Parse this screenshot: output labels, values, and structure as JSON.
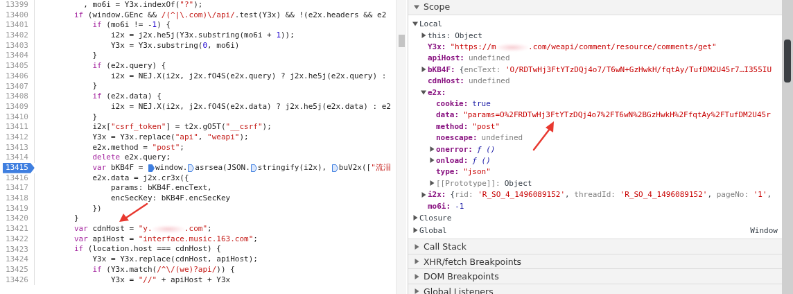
{
  "code": {
    "lines": [
      {
        "number": "13399",
        "breakpoint": false,
        "tokens": [
          {
            "kind": "plain",
            "text": "          , mo6i = Y3x.indexOf("
          },
          {
            "kind": "str",
            "text": "\"?\""
          },
          {
            "kind": "plain",
            "text": ");"
          }
        ]
      },
      {
        "number": "13400",
        "breakpoint": false,
        "tokens": [
          {
            "kind": "kw",
            "text": "        if"
          },
          {
            "kind": "plain",
            "text": " (window.GEnc && "
          },
          {
            "kind": "str",
            "text": "/(^|\\.com)\\/api/"
          },
          {
            "kind": "plain",
            "text": ".test(Y3x) && !(e2x.headers && e2"
          }
        ]
      },
      {
        "number": "13401",
        "breakpoint": false,
        "tokens": [
          {
            "kind": "kw",
            "text": "            if"
          },
          {
            "kind": "plain",
            "text": " (mo6i != -"
          },
          {
            "kind": "num",
            "text": "1"
          },
          {
            "kind": "plain",
            "text": ") {"
          }
        ]
      },
      {
        "number": "13402",
        "breakpoint": false,
        "tokens": [
          {
            "kind": "plain",
            "text": "                i2x = j2x.he5j(Y3x.substring(mo6i + "
          },
          {
            "kind": "num",
            "text": "1"
          },
          {
            "kind": "plain",
            "text": "));"
          }
        ]
      },
      {
        "number": "13403",
        "breakpoint": false,
        "tokens": [
          {
            "kind": "plain",
            "text": "                Y3x = Y3x.substring("
          },
          {
            "kind": "num",
            "text": "0"
          },
          {
            "kind": "plain",
            "text": ", mo6i)"
          }
        ]
      },
      {
        "number": "13404",
        "breakpoint": false,
        "tokens": [
          {
            "kind": "plain",
            "text": "            }"
          }
        ]
      },
      {
        "number": "13405",
        "breakpoint": false,
        "tokens": [
          {
            "kind": "kw",
            "text": "            if"
          },
          {
            "kind": "plain",
            "text": " (e2x.query) {"
          }
        ]
      },
      {
        "number": "13406",
        "breakpoint": false,
        "tokens": [
          {
            "kind": "plain",
            "text": "                i2x = NEJ.X(i2x, j2x.fO4S(e2x.query) ? j2x.he5j(e2x.query) :"
          }
        ]
      },
      {
        "number": "13407",
        "breakpoint": false,
        "tokens": [
          {
            "kind": "plain",
            "text": "            }"
          }
        ]
      },
      {
        "number": "13408",
        "breakpoint": false,
        "tokens": [
          {
            "kind": "kw",
            "text": "            if"
          },
          {
            "kind": "plain",
            "text": " (e2x.data) {"
          }
        ]
      },
      {
        "number": "13409",
        "breakpoint": false,
        "tokens": [
          {
            "kind": "plain",
            "text": "                i2x = NEJ.X(i2x, j2x.fO4S(e2x.data) ? j2x.he5j(e2x.data) : e2"
          }
        ]
      },
      {
        "number": "13410",
        "breakpoint": false,
        "tokens": [
          {
            "kind": "plain",
            "text": "            }"
          }
        ]
      },
      {
        "number": "13411",
        "breakpoint": false,
        "tokens": [
          {
            "kind": "plain",
            "text": "            i2x["
          },
          {
            "kind": "str",
            "text": "\"csrf_token\""
          },
          {
            "kind": "plain",
            "text": "] = t2x.gO5T("
          },
          {
            "kind": "str",
            "text": "\"__csrf\""
          },
          {
            "kind": "plain",
            "text": ");"
          }
        ]
      },
      {
        "number": "13412",
        "breakpoint": false,
        "tokens": [
          {
            "kind": "plain",
            "text": "            Y3x = Y3x.replace("
          },
          {
            "kind": "str",
            "text": "\"api\""
          },
          {
            "kind": "plain",
            "text": ", "
          },
          {
            "kind": "str",
            "text": "\"weapi\""
          },
          {
            "kind": "plain",
            "text": ");"
          }
        ]
      },
      {
        "number": "13413",
        "breakpoint": false,
        "tokens": [
          {
            "kind": "plain",
            "text": "            e2x.method = "
          },
          {
            "kind": "str",
            "text": "\"post\""
          },
          {
            "kind": "plain",
            "text": ";"
          }
        ]
      },
      {
        "number": "13414",
        "breakpoint": false,
        "tokens": [
          {
            "kind": "kw",
            "text": "            delete"
          },
          {
            "kind": "plain",
            "text": " e2x.query;"
          }
        ]
      },
      {
        "number": "13415",
        "breakpoint": true,
        "tokens": [
          {
            "kind": "kw",
            "text": "            var"
          },
          {
            "kind": "plain",
            "text": " bKB4F = "
          },
          {
            "kind": "marker",
            "active": true
          },
          {
            "kind": "plain",
            "text": "window."
          },
          {
            "kind": "marker",
            "active": false
          },
          {
            "kind": "plain",
            "text": "asrsea(JSON."
          },
          {
            "kind": "marker",
            "active": false
          },
          {
            "kind": "plain",
            "text": "stringify(i2x), "
          },
          {
            "kind": "marker",
            "active": false
          },
          {
            "kind": "plain",
            "text": "buV2x(["
          },
          {
            "kind": "str",
            "text": "\"流泪"
          }
        ]
      },
      {
        "number": "13416",
        "breakpoint": false,
        "tokens": [
          {
            "kind": "plain",
            "text": "            e2x.data = j2x.cr3x({"
          }
        ]
      },
      {
        "number": "13417",
        "breakpoint": false,
        "tokens": [
          {
            "kind": "plain",
            "text": "                params: bKB4F.encText,"
          }
        ]
      },
      {
        "number": "13418",
        "breakpoint": false,
        "tokens": [
          {
            "kind": "plain",
            "text": "                encSecKey: bKB4F.encSecKey"
          }
        ]
      },
      {
        "number": "13419",
        "breakpoint": false,
        "tokens": [
          {
            "kind": "plain",
            "text": "            })"
          }
        ]
      },
      {
        "number": "13420",
        "breakpoint": false,
        "tokens": [
          {
            "kind": "plain",
            "text": "        }"
          }
        ]
      },
      {
        "number": "13421",
        "breakpoint": false,
        "tokens": [
          {
            "kind": "kw",
            "text": "        var"
          },
          {
            "kind": "plain",
            "text": " cdnHost = "
          },
          {
            "kind": "str",
            "text": "\"y."
          },
          {
            "kind": "redacted"
          },
          {
            "kind": "str",
            "text": ".com\""
          },
          {
            "kind": "plain",
            "text": ";"
          }
        ]
      },
      {
        "number": "13422",
        "breakpoint": false,
        "tokens": [
          {
            "kind": "kw",
            "text": "        var"
          },
          {
            "kind": "plain",
            "text": " apiHost = "
          },
          {
            "kind": "str",
            "text": "\"interface.music.163.com\""
          },
          {
            "kind": "plain",
            "text": ";"
          }
        ]
      },
      {
        "number": "13423",
        "breakpoint": false,
        "tokens": [
          {
            "kind": "kw",
            "text": "        if"
          },
          {
            "kind": "plain",
            "text": " (location.host === cdnHost) {"
          }
        ]
      },
      {
        "number": "13424",
        "breakpoint": false,
        "tokens": [
          {
            "kind": "plain",
            "text": "            Y3x = Y3x.replace(cdnHost, apiHost);"
          }
        ]
      },
      {
        "number": "13425",
        "breakpoint": false,
        "tokens": [
          {
            "kind": "kw",
            "text": "            if"
          },
          {
            "kind": "plain",
            "text": " (Y3x.match("
          },
          {
            "kind": "str",
            "text": "/^\\/(we)?api/"
          },
          {
            "kind": "plain",
            "text": ")) {"
          }
        ]
      },
      {
        "number": "13426",
        "breakpoint": false,
        "tokens": [
          {
            "kind": "plain",
            "text": "                Y3x = "
          },
          {
            "kind": "str",
            "text": "\"//\""
          },
          {
            "kind": "plain",
            "text": " + apiHost + Y3x"
          }
        ]
      }
    ]
  },
  "sections": [
    {
      "title": "Scope",
      "expanded": true,
      "items": [
        {
          "name": "Local",
          "kind": "scope",
          "expanded": true,
          "children": [
            {
              "name": "this:",
              "kind": "plain",
              "expanded": false,
              "value": [
                {
                  "kind": "obj",
                  "text": "Object"
                }
              ]
            },
            {
              "name": "Y3x:",
              "kind": "property",
              "value": [
                {
                  "kind": "str",
                  "text": "\"https://m"
                },
                {
                  "kind": "redacted"
                },
                {
                  "kind": "str",
                  "text": ".com/weapi/comment/resource/comments/get\""
                }
              ]
            },
            {
              "name": "apiHost:",
              "kind": "property",
              "value": [
                {
                  "kind": "undef",
                  "text": "undefined"
                }
              ]
            },
            {
              "name": "bKB4F:",
              "kind": "property",
              "expanded": false,
              "value": [
                {
                  "kind": "obj",
                  "text": "{"
                },
                {
                  "kind": "key",
                  "text": "encText: "
                },
                {
                  "kind": "str",
                  "text": "'O/RDTwHj3FtYTzDQj4o7/T6wN+GzHwkH/fqtAy/TufDM2U45r7…I355IU"
                }
              ]
            },
            {
              "name": "cdnHost:",
              "kind": "property",
              "value": [
                {
                  "kind": "undef",
                  "text": "undefined"
                }
              ]
            },
            {
              "name": "e2x:",
              "kind": "property",
              "expanded": true,
              "children": [
                {
                  "name": "cookie:",
                  "kind": "property",
                  "value": [
                    {
                      "kind": "num",
                      "text": "true"
                    }
                  ]
                },
                {
                  "name": "data:",
                  "kind": "property",
                  "value": [
                    {
                      "kind": "str",
                      "text": "\"params=O%2FRDTwHj3FtYTzDQj4o7%2FT6wN%2BGzHwkH%2FfqtAy%2FTufDM2U45r"
                    }
                  ]
                },
                {
                  "name": "method:",
                  "kind": "property",
                  "value": [
                    {
                      "kind": "str",
                      "text": "\"post\""
                    }
                  ]
                },
                {
                  "name": "noescape:",
                  "kind": "property",
                  "value": [
                    {
                      "kind": "undef",
                      "text": "undefined"
                    }
                  ]
                },
                {
                  "name": "onerror:",
                  "kind": "property",
                  "expanded": false,
                  "value": [
                    {
                      "kind": "fn",
                      "text": "ƒ ()"
                    }
                  ]
                },
                {
                  "name": "onload:",
                  "kind": "property",
                  "expanded": false,
                  "value": [
                    {
                      "kind": "fn",
                      "text": "ƒ ()"
                    }
                  ]
                },
                {
                  "name": "type:",
                  "kind": "property",
                  "value": [
                    {
                      "kind": "str",
                      "text": "\"json\""
                    }
                  ]
                },
                {
                  "name": "[[Prototype]]:",
                  "kind": "internal",
                  "expanded": false,
                  "value": [
                    {
                      "kind": "obj",
                      "text": "Object"
                    }
                  ]
                }
              ]
            },
            {
              "name": "i2x:",
              "kind": "property",
              "expanded": false,
              "value": [
                {
                  "kind": "obj",
                  "text": "{"
                },
                {
                  "kind": "key",
                  "text": "rid: "
                },
                {
                  "kind": "str",
                  "text": "'R_SO_4_1496089152'"
                },
                {
                  "kind": "obj",
                  "text": ", "
                },
                {
                  "kind": "key",
                  "text": "threadId: "
                },
                {
                  "kind": "str",
                  "text": "'R_SO_4_1496089152'"
                },
                {
                  "kind": "obj",
                  "text": ", "
                },
                {
                  "kind": "key",
                  "text": "pageNo: "
                },
                {
                  "kind": "str",
                  "text": "'1'"
                },
                {
                  "kind": "obj",
                  "text": ","
                }
              ]
            },
            {
              "name": "mo6i:",
              "kind": "property",
              "value": [
                {
                  "kind": "num",
                  "text": "-1"
                }
              ]
            }
          ]
        },
        {
          "name": "Closure",
          "kind": "scope",
          "expanded": false
        },
        {
          "name": "Global",
          "kind": "scope",
          "expanded": false,
          "value": [
            {
              "kind": "obj",
              "text": "Window"
            }
          ]
        }
      ]
    },
    {
      "title": "Call Stack",
      "expanded": false
    },
    {
      "title": "XHR/fetch Breakpoints",
      "expanded": false
    },
    {
      "title": "DOM Breakpoints",
      "expanded": false
    },
    {
      "title": "Global Listeners",
      "expanded": false
    }
  ]
}
